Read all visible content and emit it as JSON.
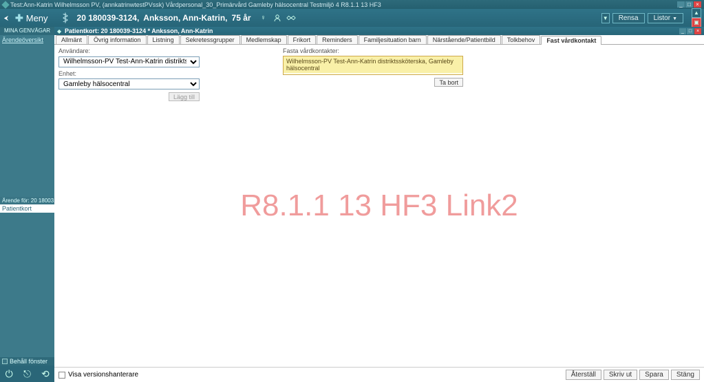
{
  "window": {
    "title": "Test:Ann-Katrin  Wilhelmsson PV, (annkatrinwtestPVssk) Vårdpersonal_30_Primärvård Gamleby hälsocentral Testmiljö 4 R8.1.1 13 HF3"
  },
  "header": {
    "meny": "Meny",
    "pid": "20 180039-3124,",
    "pname": "Anksson, Ann-Katrin,",
    "page": "75 år",
    "rensa": "Rensa",
    "listor": "Listor"
  },
  "sidebar": {
    "head": "MINA GENVÄGAR",
    "link": "Ärendeöversikt",
    "recent": "Ärende för: 20 18003...",
    "active": "Patientkort",
    "behall": "Behåll fönster"
  },
  "subheader": {
    "title": "Patientkort: 20 180039-3124 * Anksson, Ann-Katrin"
  },
  "tabs": [
    "Allmänt",
    "Övrig information",
    "Listning",
    "Sekretessgrupper",
    "Medlemskap",
    "Frikort",
    "Reminders",
    "Familjesituation barn",
    "Närstående/Patientbild",
    "Tolkbehov",
    "Fast vårdkontakt"
  ],
  "activeTab": "Fast vårdkontakt",
  "form": {
    "anvandare_label": "Användare:",
    "anvandare_value": "Wilhelmsson-PV Test-Ann-Katrin distriktssköterska",
    "enhet_label": "Enhet:",
    "enhet_value": "Gamleby hälsocentral",
    "laggtill": "Lägg till",
    "fasta_label": "Fasta vårdkontakter:",
    "fasta_row": "Wilhelmsson-PV Test-Ann-Katrin distriktssköterska, Gamleby hälsocentral",
    "tabort": "Ta bort"
  },
  "watermark": "R8.1.1 13 HF3 Link2",
  "footer": {
    "visa": "Visa versionshanterare",
    "aterstall": "Återställ",
    "skrivut": "Skriv ut",
    "spara": "Spara",
    "stang": "Stäng"
  }
}
